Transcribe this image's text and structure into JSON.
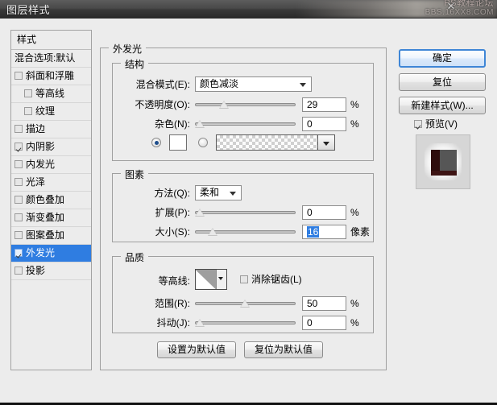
{
  "window": {
    "title": "图层样式",
    "watermark_line1": "PS教程论坛",
    "watermark_line2": "BBS.16XX8.COM",
    "close_icon": "✕"
  },
  "styles_panel": {
    "header": "样式",
    "blending_options": "混合选项:默认",
    "items": [
      {
        "label": "斜面和浮雕",
        "checked": false,
        "indent": false,
        "selected": false
      },
      {
        "label": "等高线",
        "checked": false,
        "indent": true,
        "selected": false
      },
      {
        "label": "纹理",
        "checked": false,
        "indent": true,
        "selected": false
      },
      {
        "label": "描边",
        "checked": false,
        "indent": false,
        "selected": false
      },
      {
        "label": "内阴影",
        "checked": true,
        "indent": false,
        "selected": false
      },
      {
        "label": "内发光",
        "checked": false,
        "indent": false,
        "selected": false
      },
      {
        "label": "光泽",
        "checked": false,
        "indent": false,
        "selected": false
      },
      {
        "label": "颜色叠加",
        "checked": false,
        "indent": false,
        "selected": false
      },
      {
        "label": "渐变叠加",
        "checked": false,
        "indent": false,
        "selected": false
      },
      {
        "label": "图案叠加",
        "checked": false,
        "indent": false,
        "selected": false
      },
      {
        "label": "外发光",
        "checked": true,
        "indent": false,
        "selected": true
      },
      {
        "label": "投影",
        "checked": false,
        "indent": false,
        "selected": false
      }
    ]
  },
  "main": {
    "group_title": "外发光",
    "structure": {
      "title": "结构",
      "blend_mode_label": "混合模式(E):",
      "blend_mode_value": "颜色减淡",
      "opacity_label": "不透明度(O):",
      "opacity_value": "29",
      "opacity_unit": "%",
      "noise_label": "杂色(N):",
      "noise_value": "0",
      "noise_unit": "%",
      "fill_color_selected": true,
      "fill_color_hex": "#ffffff"
    },
    "elements": {
      "title": "图素",
      "technique_label": "方法(Q):",
      "technique_value": "柔和",
      "spread_label": "扩展(P):",
      "spread_value": "0",
      "spread_unit": "%",
      "size_label": "大小(S):",
      "size_value": "16",
      "size_unit": "像素"
    },
    "quality": {
      "title": "品质",
      "contour_label": "等高线:",
      "antialias_label": "消除锯齿(L)",
      "antialias_checked": false,
      "range_label": "范围(R):",
      "range_value": "50",
      "range_unit": "%",
      "jitter_label": "抖动(J):",
      "jitter_value": "0",
      "jitter_unit": "%"
    },
    "footer": {
      "set_default": "设置为默认值",
      "reset_default": "复位为默认值"
    }
  },
  "sidebar_buttons": {
    "ok": "确定",
    "reset": "复位",
    "new_style": "新建样式(W)...",
    "preview_label": "预览(V)",
    "preview_checked": true
  }
}
